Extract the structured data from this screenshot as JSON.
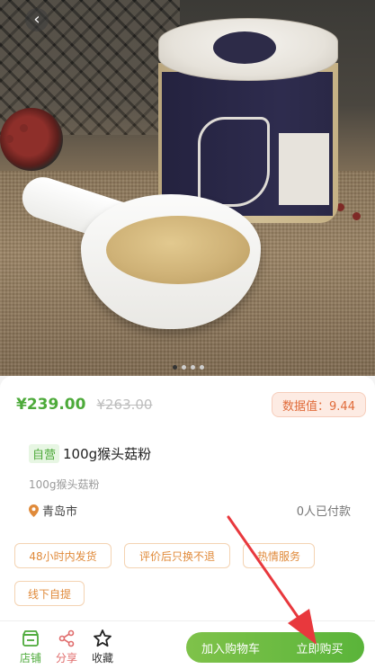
{
  "nav": {
    "back_icon": "back-arrow-icon"
  },
  "gallery": {
    "dot_count": 4,
    "active_index": 0
  },
  "product": {
    "price": "¥239.00",
    "original_price": "¥263.00",
    "score": "数据值：9.44",
    "self_operated": "自营",
    "title": "100g猴头菇粉",
    "subtitle": "100g猴头菇粉",
    "location": "青岛市",
    "paid_count": "0人已付款"
  },
  "tags": [
    "48小时内发货",
    "评价后只换不退",
    "热情服务",
    "线下自提"
  ],
  "bottom_bar": {
    "store_label": "店铺",
    "share_label": "分享",
    "favorite_label": "收藏",
    "cart_label": "加入购物车",
    "buy_label": "立即购买"
  },
  "colors": {
    "accent_green": "#4daa3a",
    "tag_orange": "#e08a3a",
    "score_orange": "#e06b3a",
    "annotation_red": "#e8383d"
  }
}
